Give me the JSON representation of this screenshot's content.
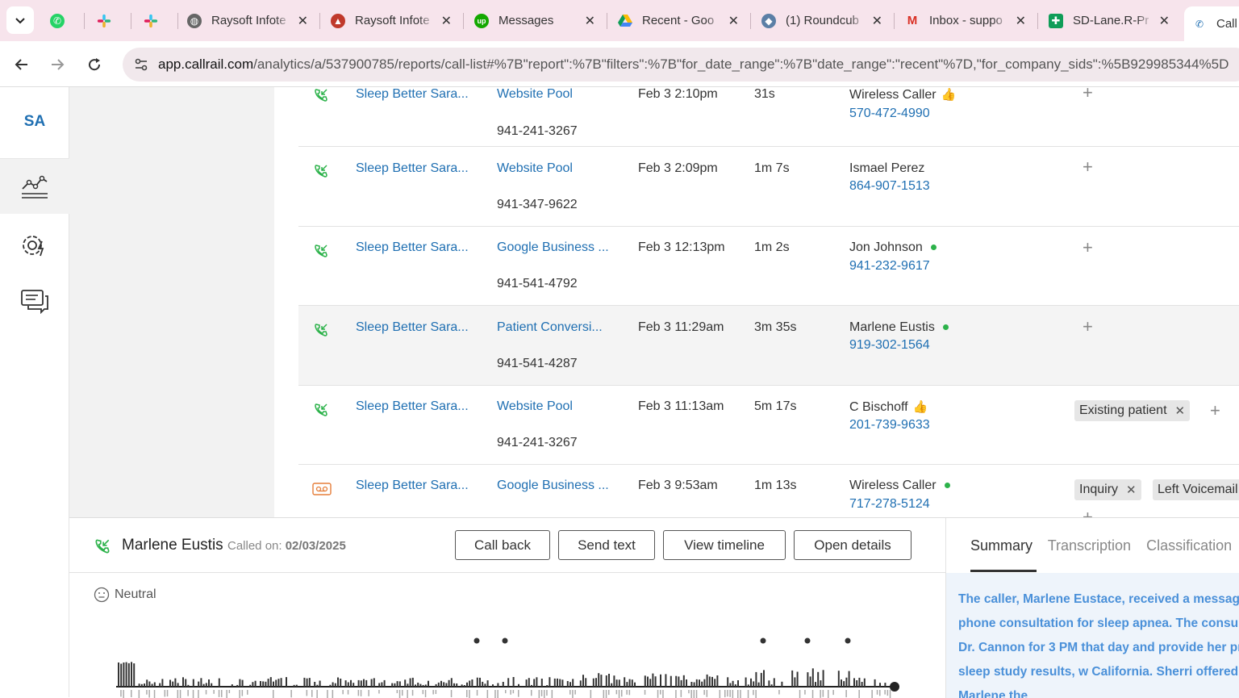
{
  "browser": {
    "tabs": [
      {
        "label": ""
      },
      {
        "label": ""
      },
      {
        "label": ""
      },
      {
        "label": "Raysoft Infote"
      },
      {
        "label": "Raysoft Infote"
      },
      {
        "label": "Messages"
      },
      {
        "label": "Recent - Goo"
      },
      {
        "label": "(1) Roundcub"
      },
      {
        "label": "Inbox - suppo"
      },
      {
        "label": "SD-Lane.R-Pr"
      },
      {
        "label": "Call"
      }
    ],
    "url_host": "app.callrail.com",
    "url_path": "/analytics/a/537900785/reports/call-list#%7B\"report\":%7B\"filters\":%7B\"for_date_range\":%7B\"date_range\":\"recent\"%7D,\"for_company_sids\":%5B929985344%5D"
  },
  "sidebar": {
    "account_initials": "SA",
    "items": [
      {
        "icon": "analytics-chart-icon"
      },
      {
        "icon": "settings-gear-icon"
      },
      {
        "icon": "chat-icon"
      }
    ]
  },
  "calls": [
    {
      "company": "Sleep Better Sara...",
      "source": "Website Pool",
      "tracking": "941-241-3267",
      "date": "Feb 3 2:10pm",
      "duration": "31s",
      "caller": "Wireless Caller",
      "phone": "570-472-4990",
      "icon": "inbound-call-icon",
      "badge": "thumb"
    },
    {
      "company": "Sleep Better Sara...",
      "source": "Website Pool",
      "tracking": "941-347-9622",
      "date": "Feb 3 2:09pm",
      "duration": "1m 7s",
      "caller": "Ismael Perez",
      "phone": "864-907-1513",
      "icon": "inbound-call-icon",
      "badge": ""
    },
    {
      "company": "Sleep Better Sara...",
      "source": "Google Business ...",
      "tracking": "941-541-4792",
      "date": "Feb 3 12:13pm",
      "duration": "1m 2s",
      "caller": "Jon Johnson",
      "phone": "941-232-9617",
      "icon": "inbound-call-icon",
      "badge": "dot"
    },
    {
      "company": "Sleep Better Sara...",
      "source": "Patient Conversi...",
      "tracking": "941-541-4287",
      "date": "Feb 3 11:29am",
      "duration": "3m 35s",
      "caller": "Marlene Eustis",
      "phone": "919-302-1564",
      "icon": "inbound-call-icon",
      "badge": "dot"
    },
    {
      "company": "Sleep Better Sara...",
      "source": "Website Pool",
      "tracking": "941-241-3267",
      "date": "Feb 3 11:13am",
      "duration": "5m 17s",
      "caller": "C Bischoff",
      "phone": "201-739-9633",
      "icon": "inbound-call-icon",
      "badge": "thumb",
      "tags": [
        "Existing patient"
      ]
    },
    {
      "company": "Sleep Better Sara...",
      "source": "Google Business ...",
      "tracking": "",
      "date": "Feb 3 9:53am",
      "duration": "1m 13s",
      "caller": "Wireless Caller",
      "phone": "717-278-5124",
      "icon": "voicemail-icon",
      "badge": "dot",
      "tags": [
        "Inquiry",
        "Left Voicemail"
      ]
    }
  ],
  "player": {
    "caller_name": "Marlene Eustis",
    "called_on_label": "Called on:",
    "called_on_date": "02/03/2025",
    "buttons": {
      "call_back": "Call back",
      "send_text": "Send text",
      "view_timeline": "View timeline",
      "open_details": "Open details"
    },
    "sentiment": "Neutral",
    "tabs": {
      "summary": "Summary",
      "transcription": "Transcription",
      "classification": "Classification"
    },
    "summary_text": "The caller, Marlene Eustace, received a message to set up a phone consultation for sleep apnea. The consultation with Dr. Cannon for 3 PM that day and provide her previous sleep study results, w California. Sherri offered to email Marlene the"
  },
  "colors": {
    "link": "#1f6fb2",
    "green": "#2cb24a",
    "tabbar": "#f7e4ec",
    "summary_text": "#4a90d9"
  }
}
